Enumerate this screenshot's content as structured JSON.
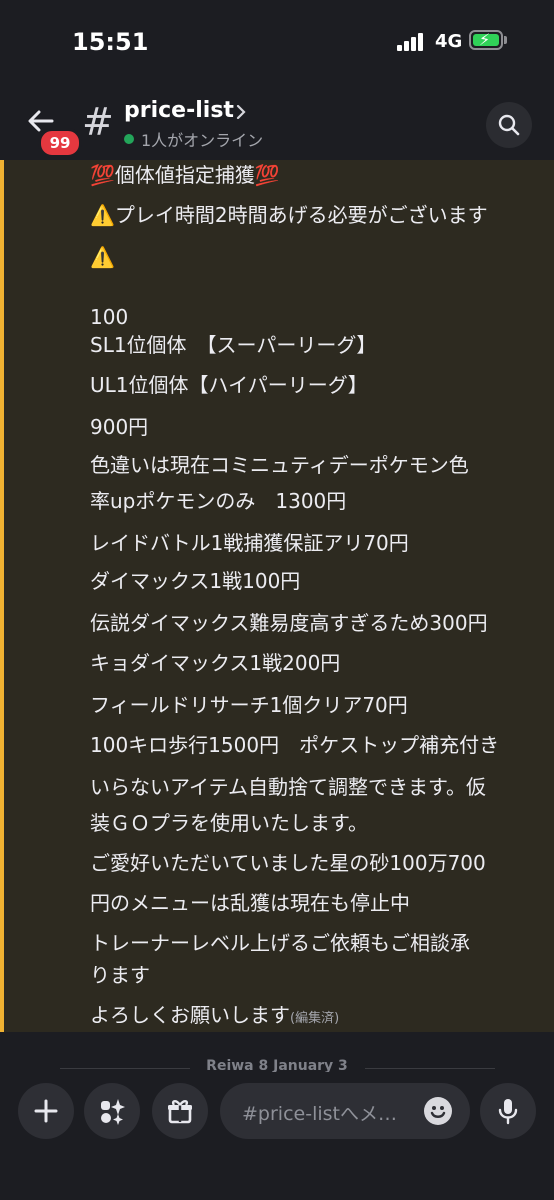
{
  "status": {
    "time": "15:51",
    "network": "4G"
  },
  "header": {
    "unread_badge": "99",
    "hash": "#",
    "channel_name": "price-list",
    "online_text": "1人がオンライン"
  },
  "message": {
    "lines": [
      "💯個体値指定捕獲💯",
      "⚠️プレイ時間2時間あげる必要がございます",
      "⚠️",
      "100",
      "SL1位個体　【スーパーリーグ】",
      "UL1位個体【ハイパーリーグ】",
      "900円",
      "色違いは現在コミニュティデーポケモン色",
      "率upポケモンのみ　1300円",
      "レイドバトル1戦捕獲保証アリ70円",
      "ダイマックス1戦100円",
      "伝説ダイマックス難易度高すぎるため300円",
      "キョダイマックス1戦200円",
      "フィールドリサーチ1個クリア70円",
      "100キロ歩行1500円　ポケストップ補充付き",
      "いらないアイテム自動捨て調整できます。仮",
      "装ＧＯプラを使用いたします。",
      "ご愛好いただいていました星の砂100万700",
      "円のメニューは乱獲は現在も停止中",
      "トレーナーレベル上げるご依頼もご相談承",
      "ります",
      "よろしくお願いします"
    ],
    "edited_label": "(編集済)"
  },
  "date_separator": "Reiwa 8 January 3",
  "composer": {
    "placeholder": "#price-listへメ…",
    "add_icon": "plus-icon",
    "apps_icon": "apps-sparkle-icon",
    "gift_icon": "gift-icon",
    "emoji_icon": "smile-icon",
    "mic_icon": "microphone-icon"
  },
  "colors": {
    "accent_bar": "#f0b232",
    "highlight_bg": "#2d2a20",
    "badge": "#e5383f",
    "online": "#23a55a"
  }
}
